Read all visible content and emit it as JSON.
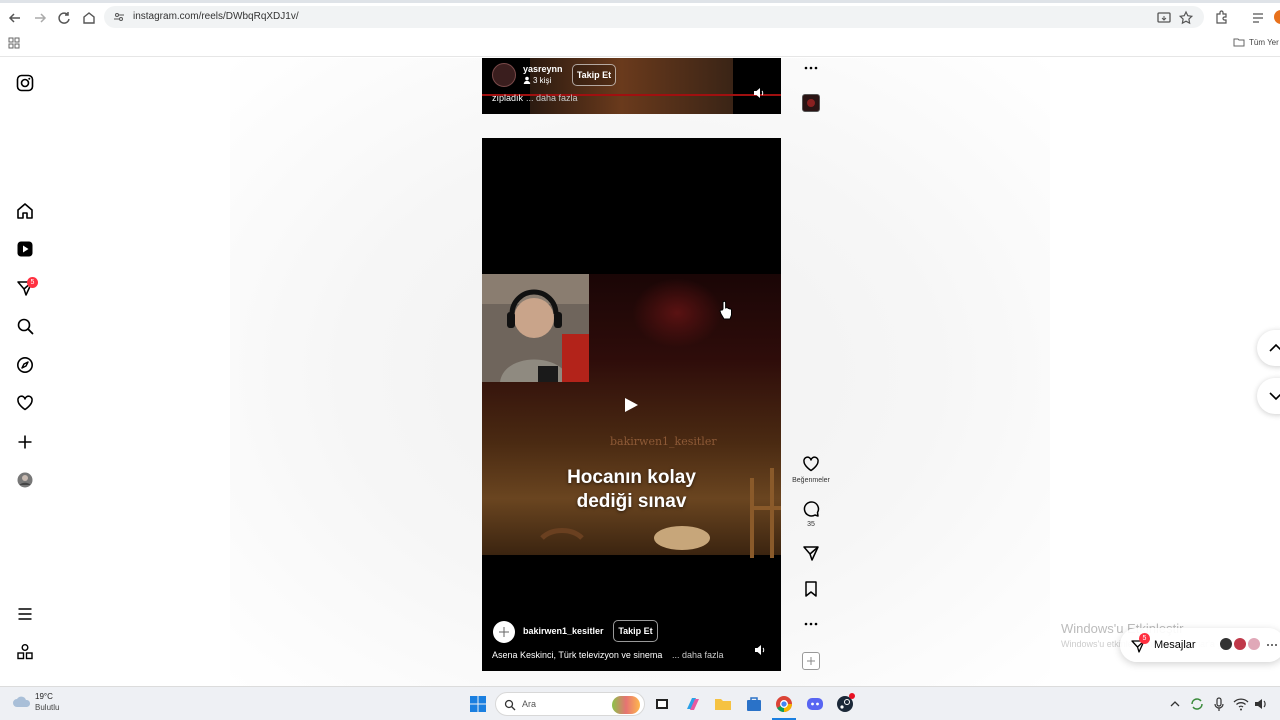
{
  "browser": {
    "url": "instagram.com/reels/DWbqRqXDJ1v/",
    "bookmarks_label": "Tüm Yer"
  },
  "sidebar": {
    "notification_count": "5"
  },
  "reels": [
    {
      "username": "yasreynn",
      "sub_info": "3 kişi",
      "follow_label": "Takip Et",
      "caption": "zıpladık",
      "more_label": "... daha fazla"
    },
    {
      "username": "bakirwen1_kesitler",
      "follow_label": "Takip Et",
      "caption": "Asena Keskinci, Türk televizyon ve sinema",
      "more_label": "... daha fazla",
      "video_watermark": "bakirwen1_kesitler",
      "overlay_text_line1": "Hocanın kolay",
      "overlay_text_line2": "dediği sınav"
    }
  ],
  "actions": {
    "like_label": "Beğenmeler",
    "comment_count": "35"
  },
  "windows": {
    "watermark_title": "Windows'u Etkinleştir",
    "watermark_sub": "Windows'u etkinleştirmek için Ayarlar'a gidin.",
    "messages_label": "Mesajlar",
    "messages_badge": "5"
  },
  "taskbar": {
    "temperature": "19°C",
    "weather": "Bulutlu",
    "search_placeholder": "Ara"
  }
}
